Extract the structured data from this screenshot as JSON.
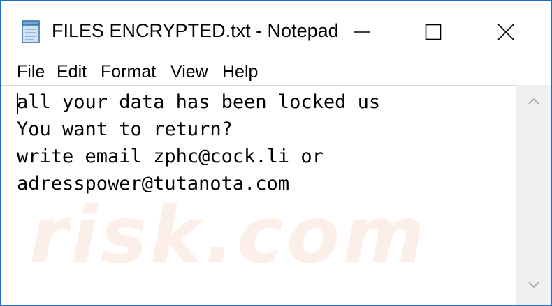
{
  "window": {
    "title": "FILES ENCRYPTED.txt - Notepad",
    "app_icon": "notepad-icon",
    "border_color": "#1b6fc9"
  },
  "controls": {
    "minimize_icon": "minimize-icon",
    "maximize_icon": "maximize-icon",
    "close_icon": "close-icon"
  },
  "menu": {
    "items": [
      "File",
      "Edit",
      "Format",
      "View",
      "Help"
    ]
  },
  "editor": {
    "lines": [
      "all your data has been locked us",
      "You want to return?",
      "write email zphc@cock.li or",
      "adresspower@tutanota.com"
    ]
  },
  "watermark": {
    "text": "risk.com"
  }
}
